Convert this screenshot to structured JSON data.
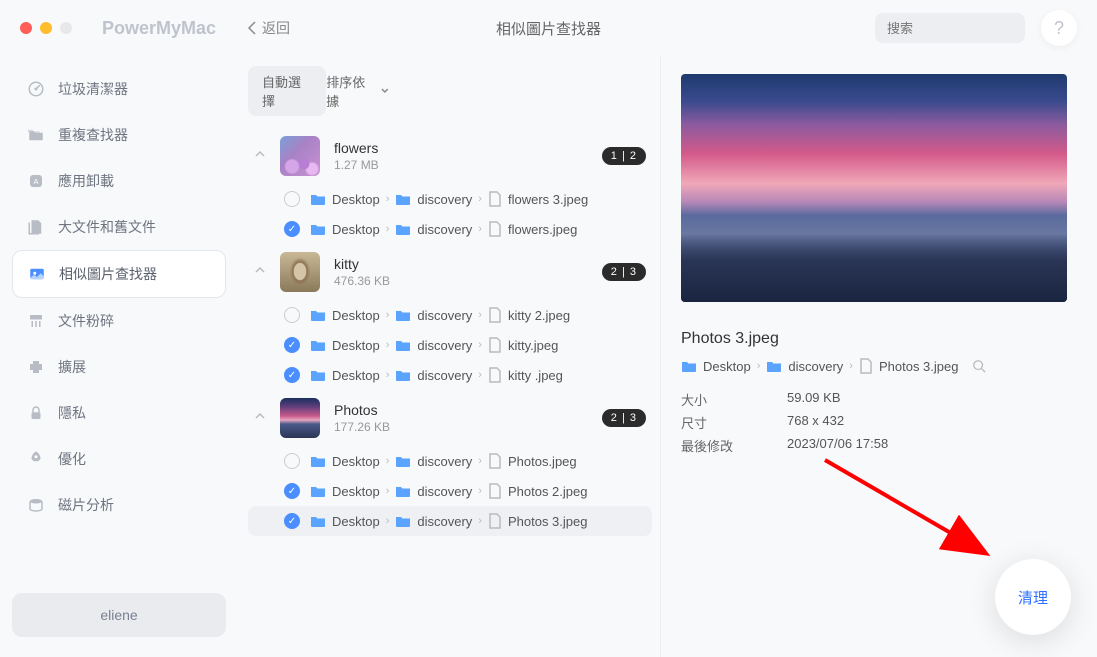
{
  "app_title": "PowerMyMac",
  "back_label": "返回",
  "window_title": "相似圖片查找器",
  "search_placeholder": "搜索",
  "help_label": "?",
  "sidebar": {
    "items": [
      {
        "label": "垃圾清潔器"
      },
      {
        "label": "重複查找器"
      },
      {
        "label": "應用卸載"
      },
      {
        "label": "大文件和舊文件"
      },
      {
        "label": "相似圖片查找器"
      },
      {
        "label": "文件粉碎"
      },
      {
        "label": "擴展"
      },
      {
        "label": "隱私"
      },
      {
        "label": "優化"
      },
      {
        "label": "磁片分析"
      }
    ],
    "user": "eliene"
  },
  "controls": {
    "auto_select": "自動選擇",
    "sort_by": "排序依據"
  },
  "path_segments": {
    "desktop": "Desktop",
    "discovery": "discovery"
  },
  "groups": [
    {
      "name": "flowers",
      "size": "1.27 MB",
      "badge": "1 | 2",
      "files": [
        {
          "checked": false,
          "name": "flowers 3.jpeg"
        },
        {
          "checked": true,
          "name": "flowers.jpeg"
        }
      ]
    },
    {
      "name": "kitty",
      "size": "476.36 KB",
      "badge": "2 | 3",
      "files": [
        {
          "checked": false,
          "name": "kitty 2.jpeg"
        },
        {
          "checked": true,
          "name": "kitty.jpeg"
        },
        {
          "checked": true,
          "name": "kitty .jpeg"
        }
      ]
    },
    {
      "name": "Photos",
      "size": "177.26 KB",
      "badge": "2 | 3",
      "files": [
        {
          "checked": false,
          "name": "Photos.jpeg"
        },
        {
          "checked": true,
          "name": "Photos 2.jpeg"
        },
        {
          "checked": true,
          "name": "Photos 3.jpeg",
          "highlighted": true
        }
      ]
    }
  ],
  "preview": {
    "filename": "Photos 3.jpeg",
    "path_file": "Photos 3.jpeg",
    "meta": {
      "size_label": "大小",
      "size_value": "59.09 KB",
      "dims_label": "尺寸",
      "dims_value": "768 x 432",
      "mod_label": "最後修改",
      "mod_value": "2023/07/06 17:58"
    }
  },
  "clean_label": "清理"
}
